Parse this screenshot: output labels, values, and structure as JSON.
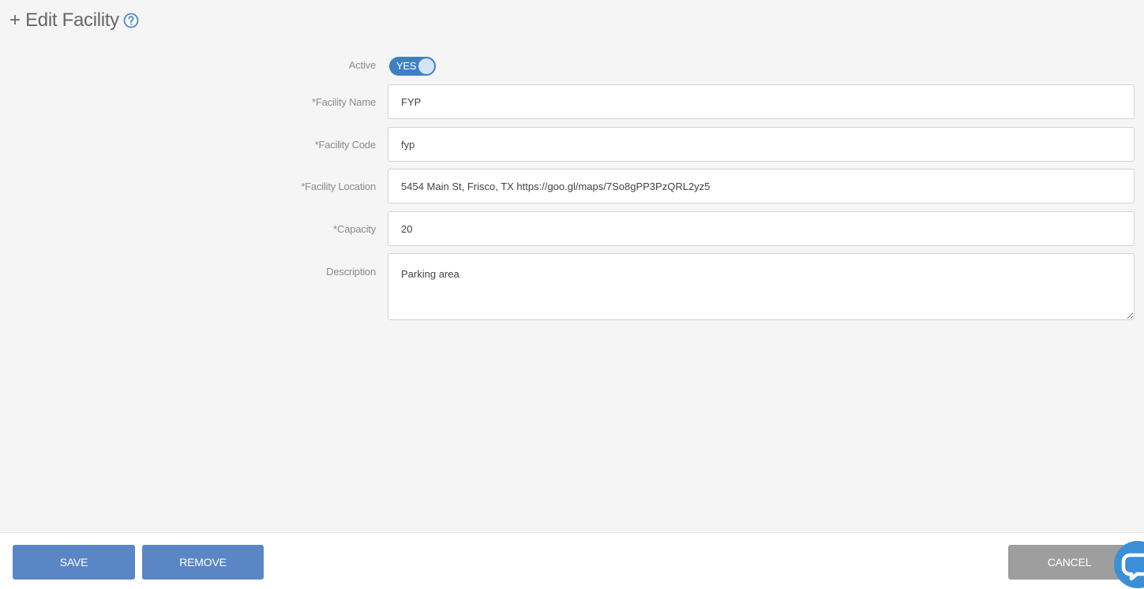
{
  "header": {
    "title": "+ Edit Facility",
    "help_icon": "question-circle-icon"
  },
  "form": {
    "active": {
      "label": "Active",
      "toggle_text": "YES",
      "on": true
    },
    "facility_name": {
      "label": "*Facility Name",
      "value": "FYP"
    },
    "facility_code": {
      "label": "*Facility Code",
      "value": "fyp"
    },
    "facility_location": {
      "label": "*Facility Location",
      "value": "5454 Main St, Frisco, TX https://goo.gl/maps/7So8gPP3PzQRL2yz5"
    },
    "capacity": {
      "label": "*Capacity",
      "value": "20"
    },
    "description": {
      "label": "Description",
      "value": "Parking area"
    }
  },
  "footer": {
    "save_label": "SAVE",
    "remove_label": "REMOVE",
    "cancel_label": "CANCEL",
    "chat_icon": "chat-bubble-icon"
  },
  "colors": {
    "primary": "#5b86c6",
    "toggle": "#3f7fc4",
    "cancel": "#9e9e9e",
    "help_icon": "#3f7fc4",
    "chat": "#3b8fd6"
  }
}
